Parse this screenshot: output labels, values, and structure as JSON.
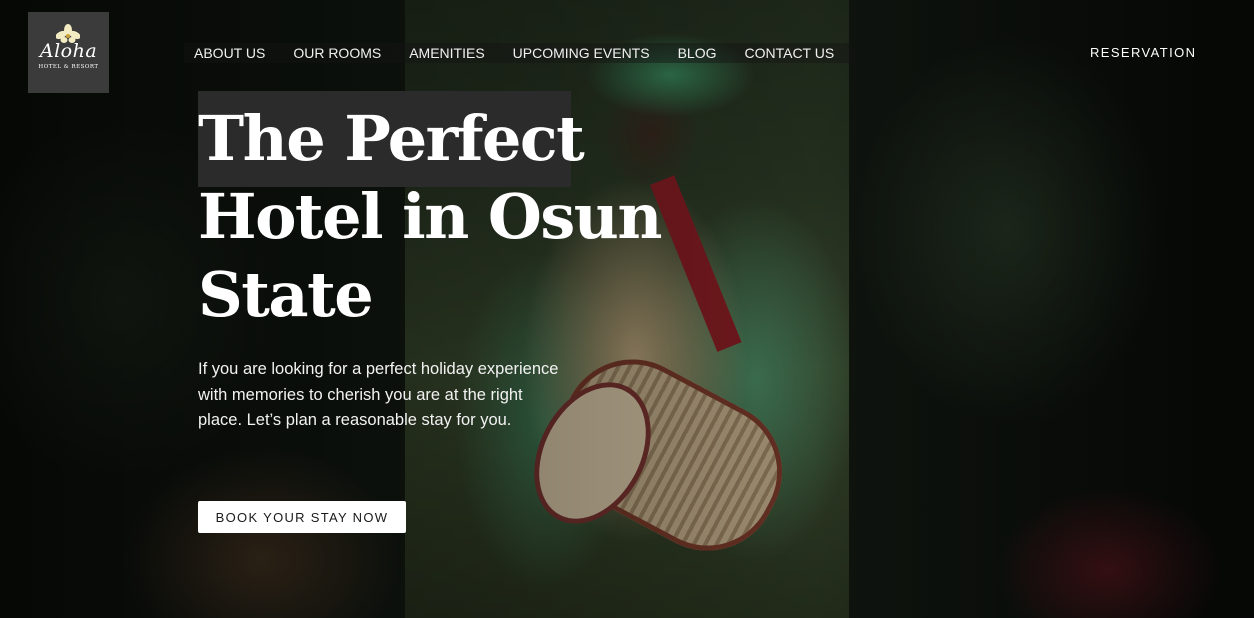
{
  "logo": {
    "brand": "Aloha",
    "subtitle": "HOTEL & RESORT",
    "icon": "flower-icon"
  },
  "nav": {
    "items": [
      {
        "label": "ABOUT US"
      },
      {
        "label": "OUR ROOMS"
      },
      {
        "label": "AMENITIES"
      },
      {
        "label": "UPCOMING EVENTS"
      },
      {
        "label": "BLOG"
      },
      {
        "label": "CONTACT US"
      }
    ],
    "reservation_label": "RESERVATION"
  },
  "hero": {
    "headline_lines": [
      "The Perfect",
      "Hotel in Osun",
      "State"
    ],
    "description": "If you are looking for a perfect holiday experience with memories to cherish you are at the right place. Let’s plan a reasonable stay for you.",
    "cta_label": "BOOK YOUR STAY NOW"
  },
  "colors": {
    "headline_highlight": "#2b2b2b",
    "logo_background": "#3b3b3b",
    "cta_background": "#ffffff",
    "text_primary": "#ffffff"
  }
}
